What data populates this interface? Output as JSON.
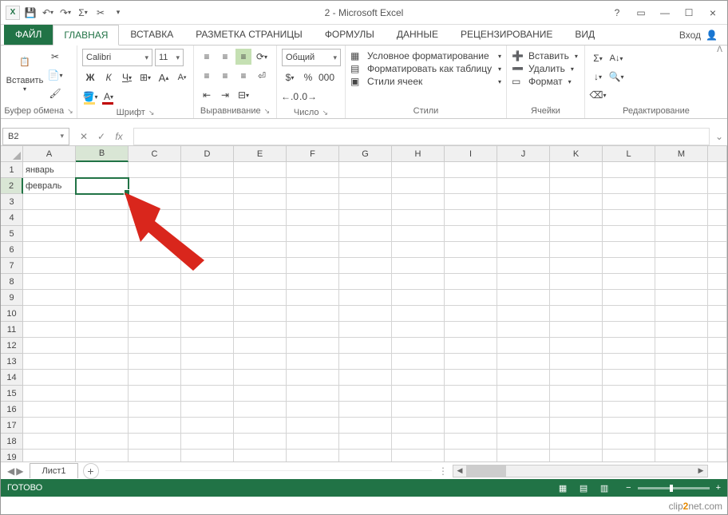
{
  "title": "2 - Microsoft Excel",
  "qat_icons": [
    "xl-logo",
    "save-icon",
    "undo-icon",
    "redo-icon",
    "autosum-icon",
    "cut-icon"
  ],
  "tabs": {
    "file": "ФАЙЛ",
    "items": [
      "ГЛАВНАЯ",
      "ВСТАВКА",
      "РАЗМЕТКА СТРАНИЦЫ",
      "ФОРМУЛЫ",
      "ДАННЫЕ",
      "РЕЦЕНЗИРОВАНИЕ",
      "ВИД"
    ],
    "active": 0,
    "login": "Вход"
  },
  "ribbon": {
    "clipboard": {
      "label": "Буфер обмена",
      "paste": "Вставить"
    },
    "font": {
      "label": "Шрифт",
      "name": "Calibri",
      "size": "11"
    },
    "alignment": {
      "label": "Выравнивание"
    },
    "number": {
      "label": "Число",
      "format": "Общий"
    },
    "styles": {
      "label": "Стили",
      "cond": "Условное форматирование",
      "table": "Форматировать как таблицу",
      "cell": "Стили ячеек"
    },
    "cells": {
      "label": "Ячейки",
      "insert": "Вставить",
      "delete": "Удалить",
      "format": "Формат"
    },
    "editing": {
      "label": "Редактирование"
    }
  },
  "namebox": "B2",
  "formula_value": "",
  "columns": [
    "A",
    "B",
    "C",
    "D",
    "E",
    "F",
    "G",
    "H",
    "I",
    "J",
    "K",
    "L",
    "M"
  ],
  "rows_count": 19,
  "cells": {
    "A1": "январь",
    "A2": "февраль"
  },
  "active_cell": "B2",
  "sel_col": 1,
  "sel_row": 1,
  "sheet": {
    "name": "Лист1"
  },
  "status": "ГОТОВО",
  "zoom": "100%",
  "watermark": {
    "pre": "clip",
    "mid": "2",
    "post": "net.com"
  }
}
